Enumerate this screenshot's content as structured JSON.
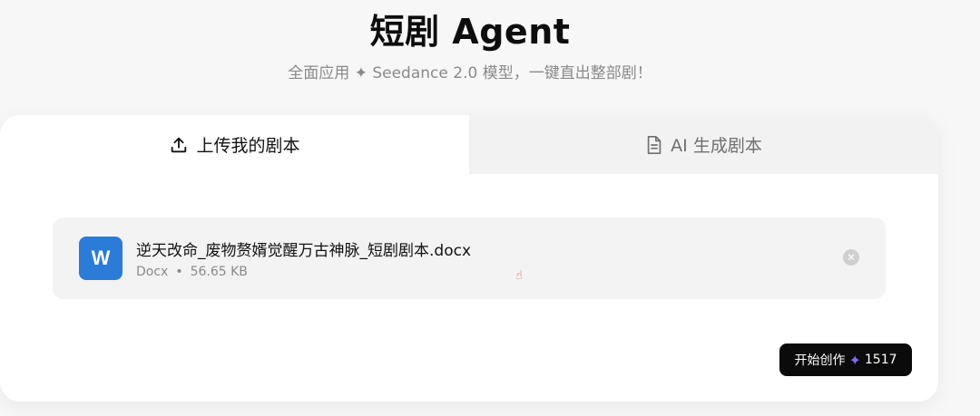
{
  "header": {
    "title": "短剧 Agent",
    "subtitle": "全面应用 ✦ Seedance 2.0 模型，一键直出整部剧！"
  },
  "tabs": [
    {
      "label": "上传我的剧本",
      "icon": "upload-icon",
      "active": true
    },
    {
      "label": "AI 生成剧本",
      "icon": "document-icon",
      "active": false
    }
  ],
  "file": {
    "icon_letter": "W",
    "name": "逆天改命_废物赘婿觉醒万古神脉_短剧剧本.docx",
    "type": "Docx",
    "separator": "•",
    "size": "56.65 KB"
  },
  "start_button": {
    "label": "开始创作",
    "icon": "sparkle-icon",
    "credits": "1517"
  },
  "colors": {
    "file_icon_bg": "#2b7bd8",
    "button_bg": "#0b0b0b",
    "sparkle": "#7b6cf6"
  }
}
